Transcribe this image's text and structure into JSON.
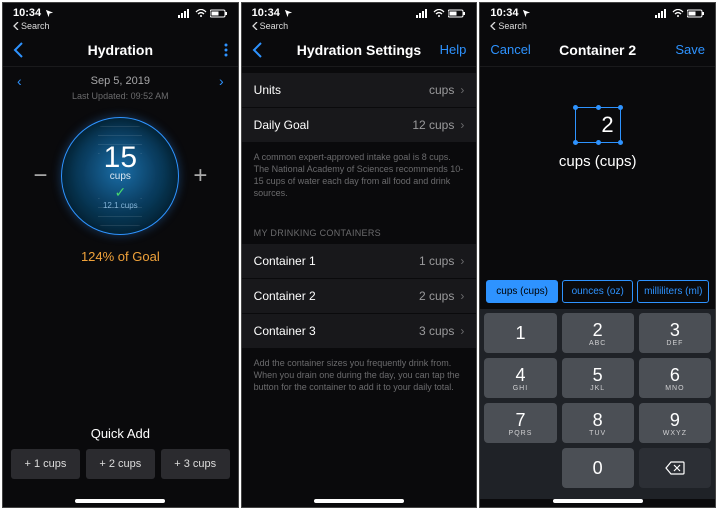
{
  "status": {
    "time": "10:34",
    "back": "Search"
  },
  "colors": {
    "accent": "#2e93ff",
    "goal": "#f0a23a"
  },
  "screen1": {
    "title": "Hydration",
    "date": "Sep 5, 2019",
    "updated": "Last Updated: 09:52 AM",
    "value": "15",
    "unit": "cups",
    "goal_line": "12.1 cups",
    "goal_pct": "124% of Goal",
    "quickadd_title": "Quick Add",
    "quickadd": [
      "+ 1 cups",
      "+ 2 cups",
      "+ 3 cups"
    ]
  },
  "screen2": {
    "title": "Hydration Settings",
    "help": "Help",
    "units_label": "Units",
    "units_value": "cups",
    "goal_label": "Daily Goal",
    "goal_value": "12 cups",
    "goal_note": "A common expert-approved intake goal is 8 cups. The National Academy of Sciences recommends 10-15 cups of water each day from all food and drink sources.",
    "containers_header": "MY DRINKING CONTAINERS",
    "containers": [
      {
        "label": "Container 1",
        "value": "1 cups"
      },
      {
        "label": "Container 2",
        "value": "2 cups"
      },
      {
        "label": "Container 3",
        "value": "3 cups"
      }
    ],
    "containers_note": "Add the container sizes you frequently drink from. When you drain one during the day, you can tap the button for the container to add it to your daily total."
  },
  "screen3": {
    "cancel": "Cancel",
    "title": "Container 2",
    "save": "Save",
    "value": "2",
    "unit_label": "cups (cups)",
    "segments": [
      "cups (cups)",
      "ounces (oz)",
      "milliliters (ml)"
    ],
    "keys": [
      [
        "1",
        ""
      ],
      [
        "2",
        "ABC"
      ],
      [
        "3",
        "DEF"
      ],
      [
        "4",
        "GHI"
      ],
      [
        "5",
        "JKL"
      ],
      [
        "6",
        "MNO"
      ],
      [
        "7",
        "PQRS"
      ],
      [
        "8",
        "TUV"
      ],
      [
        "9",
        "WXYZ"
      ]
    ],
    "zero": "0"
  }
}
